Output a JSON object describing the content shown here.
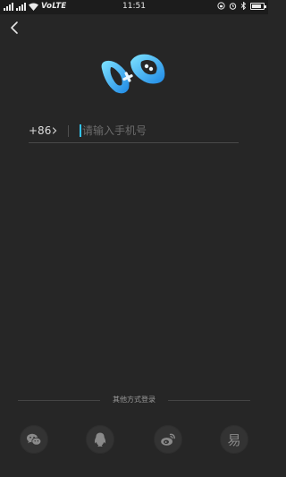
{
  "status_bar": {
    "network_label": "VoLTE",
    "time": "11:51",
    "battery_level": 0.8,
    "icons": [
      "signal-icon",
      "wifi-icon",
      "lock-rotation-icon",
      "alarm-icon",
      "bluetooth-icon",
      "battery-icon"
    ]
  },
  "nav": {
    "back_icon": "back-chevron-icon"
  },
  "logo": {
    "icon": "gamepad-logo-icon",
    "accent_color": "#29b6f6"
  },
  "login": {
    "country_code": "+86",
    "phone_placeholder": "请输入手机号",
    "phone_value": ""
  },
  "other_login": {
    "label": "其他方式登录",
    "providers": [
      {
        "name": "wechat",
        "icon": "wechat-icon"
      },
      {
        "name": "qq",
        "icon": "qq-icon"
      },
      {
        "name": "weibo",
        "icon": "weibo-icon"
      },
      {
        "name": "netease",
        "icon": "netease-icon",
        "glyph": "易"
      }
    ]
  },
  "colors": {
    "background": "#262626",
    "cursor": "#33c3ee",
    "divider": "#4a4a4a",
    "icon_gray": "#8a8a8a"
  }
}
